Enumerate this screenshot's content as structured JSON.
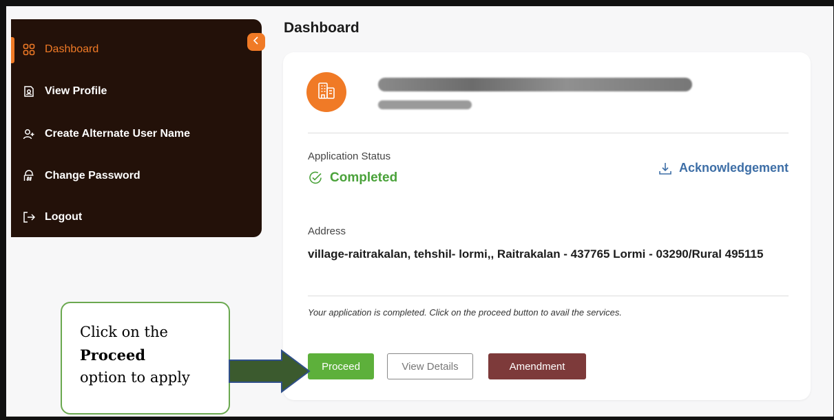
{
  "sidebar": {
    "items": [
      {
        "label": "Dashboard",
        "icon": "grid-icon",
        "active": true
      },
      {
        "label": "View Profile",
        "icon": "profile-icon"
      },
      {
        "label": "Create Alternate User Name",
        "icon": "add-user-icon"
      },
      {
        "label": "Change Password",
        "icon": "lock-hash-icon"
      },
      {
        "label": "Logout",
        "icon": "logout-icon"
      }
    ],
    "collapse_icon": "chevron-left-icon"
  },
  "page": {
    "title": "Dashboard"
  },
  "card": {
    "avatar_icon": "building-icon",
    "status_label": "Application Status",
    "status_value": "Completed",
    "ack_label": "Acknowledgement",
    "address_label": "Address",
    "address_value": "village-raitrakalan, tehshil- lormi,, Raitrakalan - 437765 Lormi - 03290/Rural 495115",
    "note": "Your application is completed. Click on the proceed button to avail the services.",
    "buttons": {
      "proceed": "Proceed",
      "view_details": "View Details",
      "amendment": "Amendment"
    }
  },
  "callout": {
    "line1": "Click on the",
    "line2": "Proceed",
    "line3": "option to apply"
  },
  "colors": {
    "accent": "#f07a26",
    "sidebar_bg": "#231109",
    "success": "#4aa23a",
    "link": "#3d6ea6",
    "amend": "#7d3a3a"
  }
}
